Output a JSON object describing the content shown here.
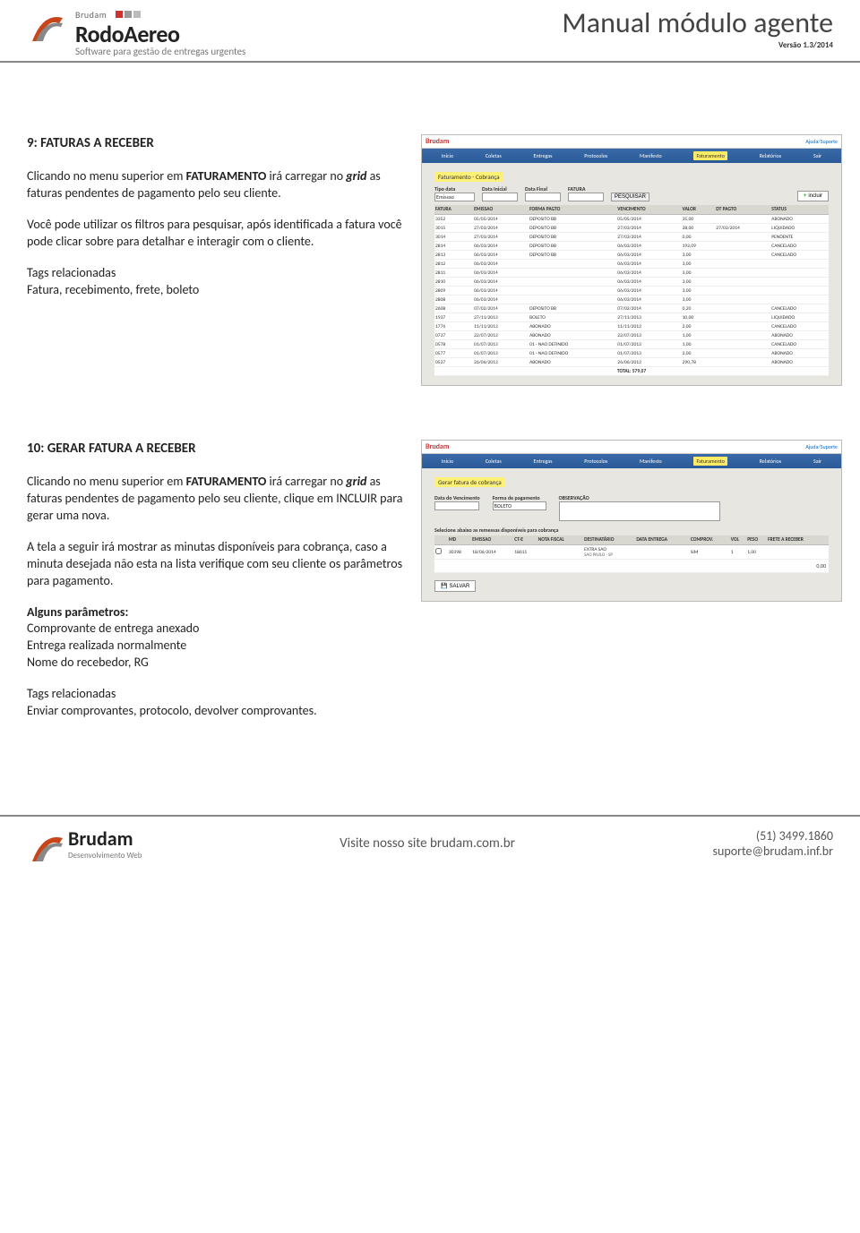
{
  "header": {
    "brand_small": "Brudam",
    "brand_title": "RodoAereo",
    "brand_sub": "Software para gestão de entregas urgentes",
    "manual_title": "Manual módulo agente",
    "version": "Versão 1.3/2014"
  },
  "section9": {
    "title": "9: FATURAS A RECEBER",
    "p1a": "Clicando no menu superior em ",
    "p1b": "FATURAMENTO",
    "p1c": " irá carregar no ",
    "p1d": "grid",
    "p1e": " as faturas pendentes de pagamento pelo seu cliente.",
    "p2": "Você pode utilizar os filtros para pesquisar, após identificada a fatura você pode clicar sobre para detalhar e interagir com o cliente.",
    "tags_label": "Tags relacionadas",
    "tags": "Fatura, recebimento, frete, boleto"
  },
  "screenshot1": {
    "brand": "Brudam",
    "help": "Ajuda/Suporte",
    "menu": [
      "Início",
      "Coletas",
      "Entregas",
      "Protocolos",
      "Manifesto",
      "Faturamento",
      "Relatórios",
      "Sair"
    ],
    "panel_title": "Faturamento - Cobrança",
    "filters": {
      "tipo": "Tipo data",
      "di": "Data Inicial",
      "df": "Data Final",
      "fat": "FATURA",
      "sel_val": "Emissao",
      "pesq": "PESQUISAR",
      "incluir": "incluir"
    },
    "cols": [
      "FATURA",
      "EMISSAO",
      "FORMA PAGTO",
      "VENCIMENTO",
      "VALOR",
      "DT PAGTO",
      "STATUS"
    ],
    "rows": [
      [
        "3352",
        "05/05/2014",
        "DEPOSITO BB",
        "05/05/2014",
        "35,00",
        "",
        "ABONADO"
      ],
      [
        "3015",
        "27/03/2014",
        "DEPOSITO BB",
        "27/03/2014",
        "28,00",
        "27/03/2014",
        "LIQUIDADO"
      ],
      [
        "3014",
        "27/03/2014",
        "DEPOSITO BB",
        "27/03/2014",
        "0,00",
        "",
        "PENDENTE"
      ],
      [
        "2814",
        "06/03/2014",
        "DEPOSITO BB",
        "06/03/2014",
        "192,09",
        "",
        "CANCELADO"
      ],
      [
        "2813",
        "06/03/2014",
        "DEPOSITO BB",
        "06/03/2014",
        "3,00",
        "",
        "CANCELADO"
      ],
      [
        "2812",
        "06/03/2014",
        "",
        "06/03/2014",
        "3,00",
        "",
        ""
      ],
      [
        "2811",
        "06/03/2014",
        "",
        "06/03/2014",
        "3,00",
        "",
        ""
      ],
      [
        "2810",
        "06/03/2014",
        "",
        "06/03/2014",
        "3,00",
        "",
        ""
      ],
      [
        "2809",
        "06/03/2014",
        "",
        "06/03/2014",
        "3,00",
        "",
        ""
      ],
      [
        "2808",
        "06/03/2014",
        "",
        "06/03/2014",
        "3,00",
        "",
        ""
      ],
      [
        "2608",
        "07/02/2014",
        "DEPOSITO BB",
        "07/02/2014",
        "0,20",
        "",
        "CANCELADO"
      ],
      [
        "1937",
        "27/11/2013",
        "BOLETO",
        "27/11/2013",
        "10,00",
        "",
        "LIQUIDADO"
      ],
      [
        "1776",
        "11/11/2013",
        "ABONADO",
        "11/11/2013",
        "2,00",
        "",
        "CANCELADO"
      ],
      [
        "0737",
        "22/07/2013",
        "ABONADO",
        "22/07/2013",
        "1,00",
        "",
        "ABONADO"
      ],
      [
        "0578",
        "01/07/2013",
        "01 - NAO DEFINIDO",
        "01/07/2013",
        "1,00",
        "",
        "CANCELADO"
      ],
      [
        "0577",
        "01/07/2013",
        "01 - NAO DEFINIDO",
        "01/07/2013",
        "2,00",
        "",
        "ABONADO"
      ],
      [
        "0527",
        "26/06/2013",
        "ABONADO",
        "26/06/2013",
        "290,78",
        "",
        "ABONADO"
      ]
    ],
    "total": "TOTAL: 579,07"
  },
  "section10": {
    "title": "10: GERAR FATURA A RECEBER",
    "p1a": "Clicando no menu superior em ",
    "p1b": "FATURAMENTO",
    "p1c": " irá carregar no ",
    "p1d": "grid",
    "p1e": " as faturas pendentes de pagamento pelo seu cliente, clique em INCLUIR para gerar uma nova.",
    "p2": "A tela a seguir irá mostrar as minutas disponíveis para cobrança, caso a minuta desejada não esta na lista verifique com seu cliente os parâmetros para pagamento.",
    "params_label": "Alguns parâmetros:",
    "param1": "Comprovante de entrega anexado",
    "param2": "Entrega realizada normalmente",
    "param3": "Nome do recebedor, RG",
    "tags_label": "Tags relacionadas",
    "tags": "Enviar comprovantes, protocolo, devolver comprovantes."
  },
  "screenshot2": {
    "panel_title": "Gerar fatura de cobrança",
    "lbl_venc": "Data do Vencimento",
    "lbl_forma": "Forma de pagamento",
    "lbl_obs": "OBSERVAÇÃO",
    "forma_val": "BOLETO",
    "selecione": "Selecione abaixo as remessas disponíveis para cobrança",
    "cols": [
      "",
      "MD",
      "EMISSAO",
      "CT-E",
      "NOTA FISCAL",
      "DESTINATÁRIO",
      "DATA ENTREGA",
      "COMPROV.",
      "VOL",
      "PESO",
      "FRETE A RECEBER"
    ],
    "row": [
      "",
      "30398",
      "18/06/2014",
      "18611",
      "",
      "EXTRA SAO",
      "",
      "SIM",
      "1",
      "1,00",
      ""
    ],
    "row_sub": "SAO PAULO - SP",
    "total": "0,00",
    "salvar": "SALVAR"
  },
  "footer": {
    "brand": "Brudam",
    "brand_sub": "Desenvolvimento Web",
    "center": "Visite nosso site brudam.com.br",
    "phone": "(51) 3499.1860",
    "email": "suporte@brudam.inf.br"
  }
}
